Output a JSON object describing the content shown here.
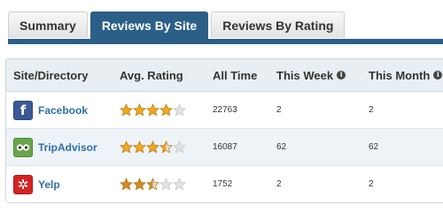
{
  "tabs": [
    {
      "label": "Summary",
      "active": false
    },
    {
      "label": "Reviews By Site",
      "active": true
    },
    {
      "label": "Reviews By Rating",
      "active": false
    }
  ],
  "table": {
    "headers": {
      "site": "Site/Directory",
      "rating": "Avg. Rating",
      "all_time": "All Time",
      "this_week": "This Week",
      "this_month": "This Month"
    },
    "rows": [
      {
        "site": "Facebook",
        "icon": "facebook-icon",
        "rating": 4,
        "all_time": "22763",
        "this_week": "2",
        "this_month": "2"
      },
      {
        "site": "TripAdvisor",
        "icon": "tripadvisor-icon",
        "rating": 3.5,
        "all_time": "16087",
        "this_week": "62",
        "this_month": "62"
      },
      {
        "site": "Yelp",
        "icon": "yelp-icon",
        "rating": 2.5,
        "all_time": "1752",
        "this_week": "2",
        "this_month": "2"
      }
    ]
  },
  "colors": {
    "accent": "#2c5f88",
    "link": "#2f6fa8",
    "star_fill": "#f2a81d",
    "star_fill_low": "#d08a26",
    "star_empty": "#e2e2e2"
  }
}
